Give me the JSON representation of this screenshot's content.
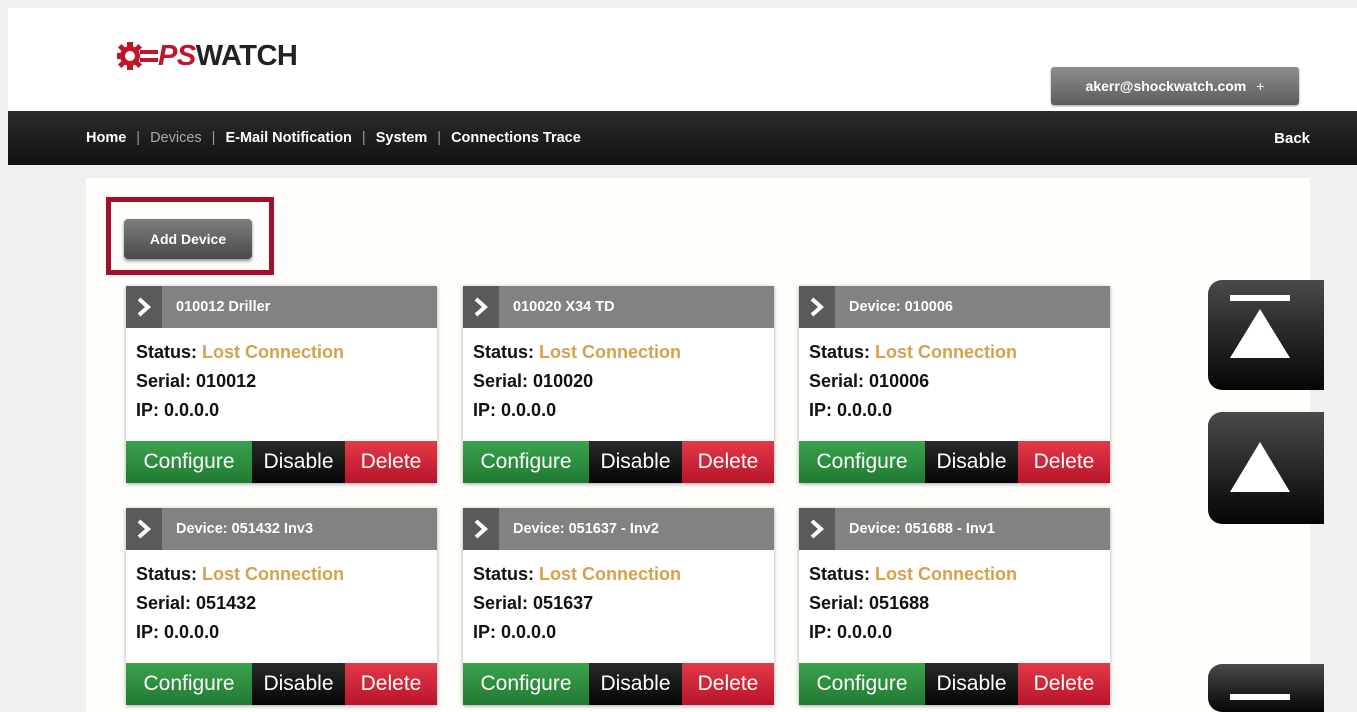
{
  "header": {
    "logo_text": "OPSWATCH",
    "user_email": "akerr@shockwatch.com",
    "user_menu_icon": "+"
  },
  "nav": {
    "items": [
      {
        "label": "Home",
        "current": false
      },
      {
        "label": "Devices",
        "current": true
      },
      {
        "label": "E-Mail Notification",
        "current": false
      },
      {
        "label": "System",
        "current": false
      },
      {
        "label": "Connections Trace",
        "current": false
      }
    ],
    "separator": "|",
    "back_label": "Back"
  },
  "toolbar": {
    "add_device_label": "Add Device"
  },
  "devices": [
    {
      "title": "010012 Driller",
      "status_label": "Status:",
      "status": "Lost Connection",
      "serial_label": "Serial:",
      "serial": "010012",
      "ip_label": "IP:",
      "ip": "0.0.0.0"
    },
    {
      "title": "010020 X34 TD",
      "status_label": "Status:",
      "status": "Lost Connection",
      "serial_label": "Serial:",
      "serial": "010020",
      "ip_label": "IP:",
      "ip": "0.0.0.0"
    },
    {
      "title": "Device: 010006",
      "status_label": "Status:",
      "status": "Lost Connection",
      "serial_label": "Serial:",
      "serial": "010006",
      "ip_label": "IP:",
      "ip": "0.0.0.0"
    },
    {
      "title": "Device: 051432 Inv3",
      "status_label": "Status:",
      "status": "Lost Connection",
      "serial_label": "Serial:",
      "serial": "051432",
      "ip_label": "IP:",
      "ip": "0.0.0.0"
    },
    {
      "title": "Device: 051637 - Inv2",
      "status_label": "Status:",
      "status": "Lost Connection",
      "serial_label": "Serial:",
      "serial": "051637",
      "ip_label": "IP:",
      "ip": "0.0.0.0"
    },
    {
      "title": "Device: 051688 - Inv1",
      "status_label": "Status:",
      "status": "Lost Connection",
      "serial_label": "Serial:",
      "serial": "051688",
      "ip_label": "IP:",
      "ip": "0.0.0.0"
    }
  ],
  "actions": {
    "configure": "Configure",
    "disable": "Disable",
    "delete": "Delete"
  },
  "colors": {
    "status_lost": "#d3a24c",
    "configure_bg": "#2e9140",
    "disable_bg": "#111111",
    "delete_bg": "#d1283a",
    "highlight_border": "#a3102e",
    "nav_bg": "#1a1a1a"
  },
  "icons": {
    "card_expand": "chevron-right-icon",
    "scroll_top": "scroll-to-top-icon",
    "scroll_up": "scroll-up-icon",
    "scroll_down": "scroll-to-bottom-icon"
  }
}
